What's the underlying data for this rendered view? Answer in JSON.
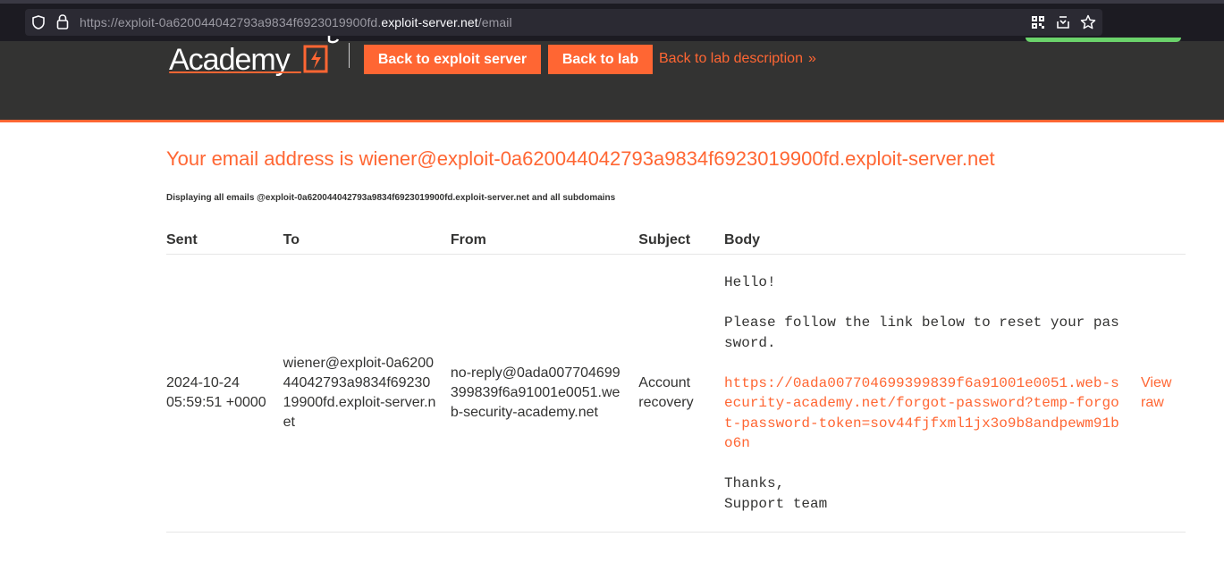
{
  "browser": {
    "url_prefix": "https://exploit-0a620044042793a9834f6923019900fd.",
    "url_host": "exploit-server.net",
    "url_path": "/email"
  },
  "header": {
    "logo_text": "Academy",
    "back_to_exploit_server": "Back to exploit server",
    "back_to_lab": "Back to lab",
    "back_to_lab_description": "Back to lab description",
    "chevron": "»"
  },
  "main": {
    "title": "Your email address is wiener@exploit-0a620044042793a9834f6923019900fd.exploit-server.net",
    "note": "Displaying all emails @exploit-0a620044042793a9834f6923019900fd.exploit-server.net and all subdomains",
    "columns": [
      "Sent",
      "To",
      "From",
      "Subject",
      "Body"
    ],
    "emails": [
      {
        "sent_date": "2024-10-24",
        "sent_time": "05:59:51 +0000",
        "to": "wiener@exploit-0a620044042793a9834f6923019900fd.exploit-server.net",
        "from": "no-reply@0ada007704699399839f6a91001e0051.web-security-academy.net",
        "subject": "Account recovery",
        "body_greeting": "Hello!",
        "body_instruction": "Please follow the link below to reset your password.",
        "body_link": "https://0ada007704699399839f6a91001e0051.web-security-academy.net/forgot-password?temp-forgot-password-token=sov44fjfxml1jx3o9b8andpewm91bo6n",
        "body_thanks": "Thanks,",
        "body_signoff": "Support team",
        "view_raw": "View raw"
      }
    ]
  },
  "colors": {
    "accent": "#ff6633",
    "header_bg": "#333332",
    "browser_bg": "#1c1b22"
  }
}
